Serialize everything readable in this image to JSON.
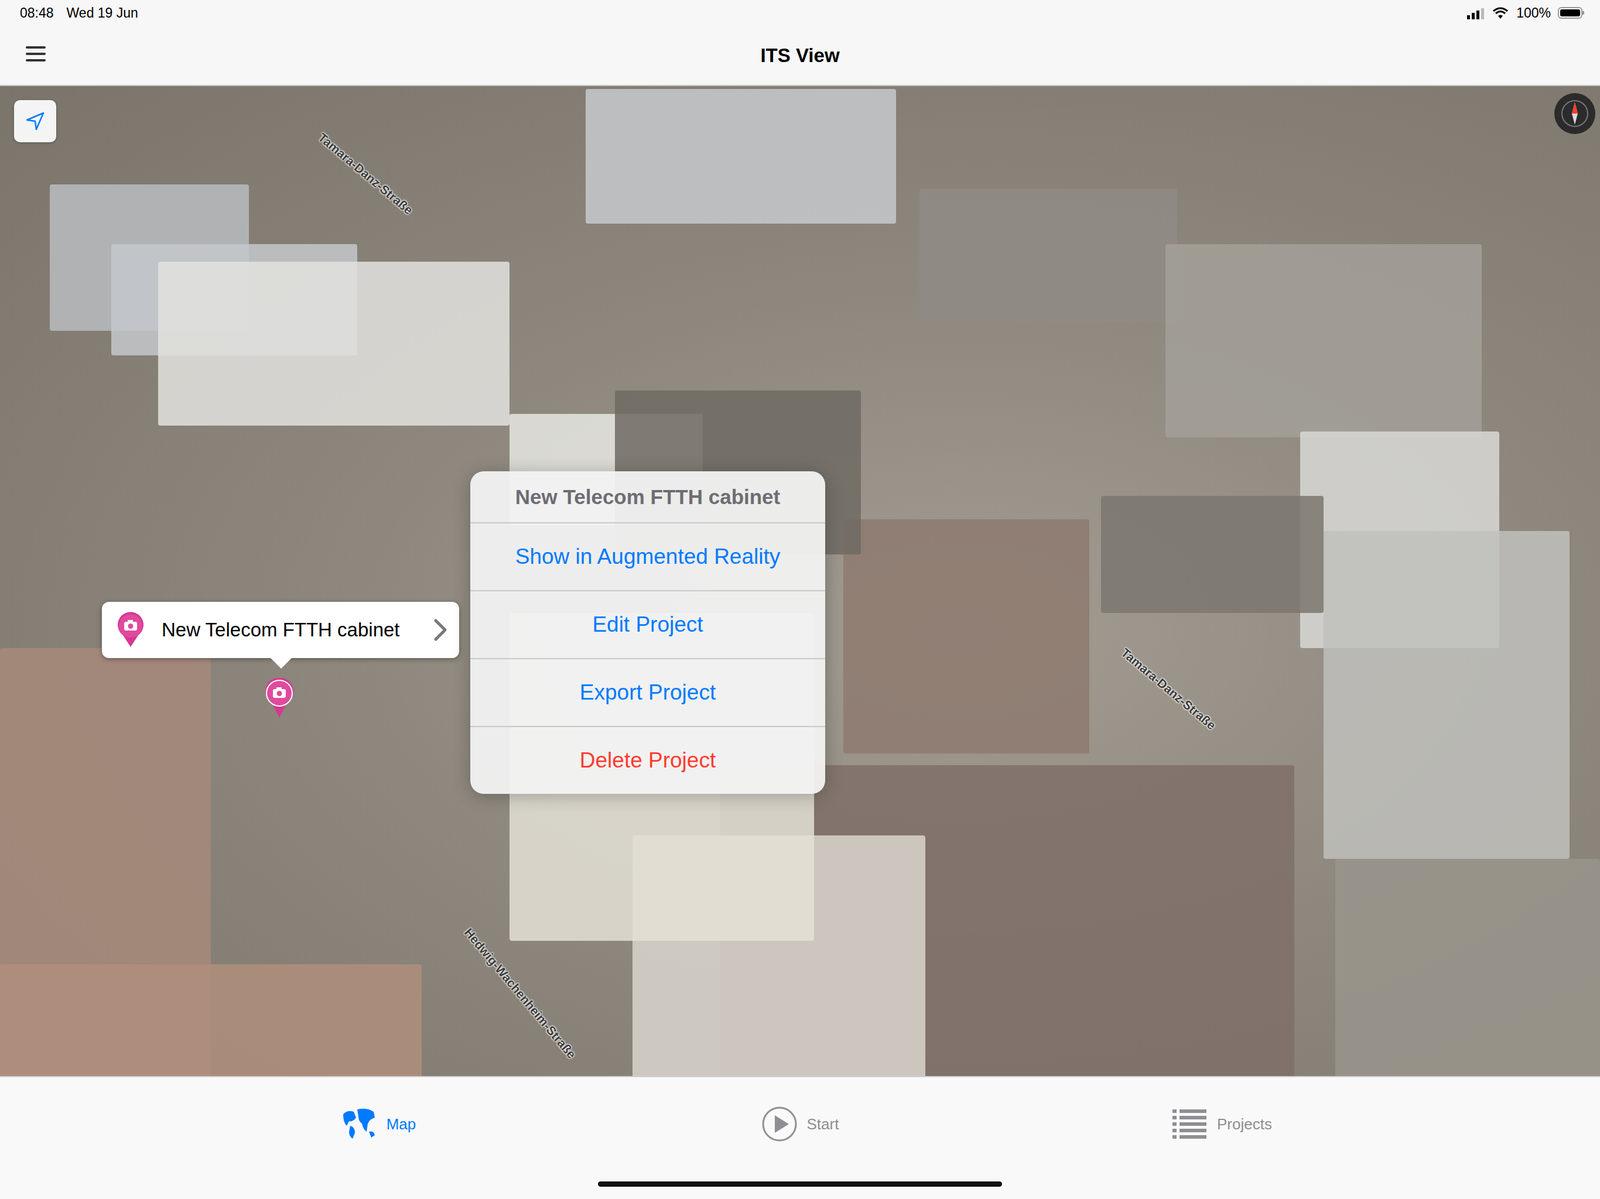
{
  "status_bar": {
    "time": "08:48",
    "date": "Wed 19 Jun",
    "battery": "100%"
  },
  "nav_bar": {
    "title": "ITS View"
  },
  "map": {
    "street_labels": [
      {
        "text": "Tamara-Danz-Straße"
      },
      {
        "text": "Tamara-Danz-Straße"
      },
      {
        "text": "Hedwig-Wachenheim-Straße"
      }
    ],
    "pin": {
      "callout": "New Telecom FTTH cabinet"
    }
  },
  "action_sheet": {
    "title": "New Telecom FTTH cabinet",
    "actions": [
      {
        "label": "Show in Augmented Reality",
        "destructive": false
      },
      {
        "label": "Edit Project",
        "destructive": false
      },
      {
        "label": "Export Project",
        "destructive": false
      },
      {
        "label": "Delete Project",
        "destructive": true
      }
    ]
  },
  "tab_bar": {
    "tabs": [
      {
        "label": "Map",
        "selected": true
      },
      {
        "label": "Start",
        "selected": false
      },
      {
        "label": "Projects",
        "selected": false
      }
    ]
  }
}
